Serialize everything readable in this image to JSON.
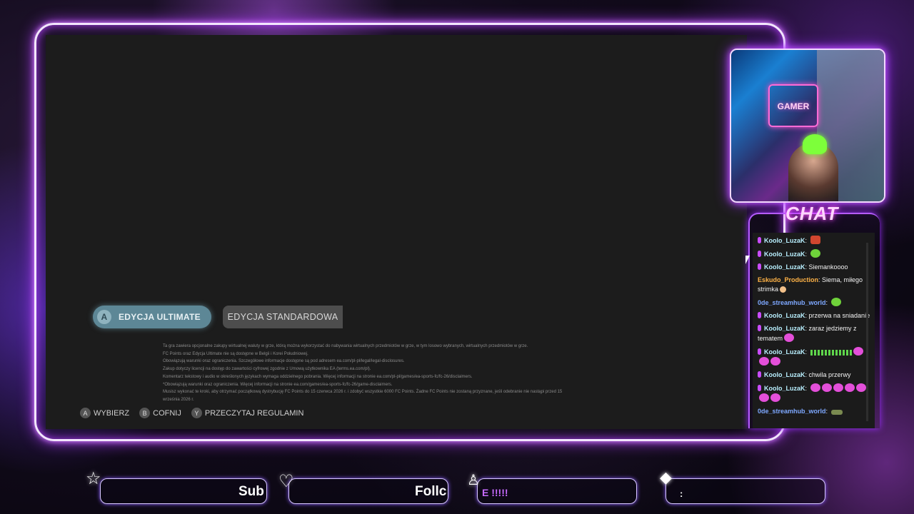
{
  "game_screen": {
    "edition_ultimate": {
      "button_key": "A",
      "label": "EDYCJA ULTIMATE"
    },
    "edition_standard": {
      "label": "EDYCJA STANDARDOWA"
    },
    "legal_lines": [
      "Ta gra zawiera opcjonalne zakupy wirtualnej waluty w grze, którą można wykorzystać do nabywania wirtualnych przedmiotów w grze, w tym losowo wybranych, wirtualnych przedmiotów w grze.",
      "FC Points oraz Edycja Ultimate nie są dostępne w Belgii i Korei Południowej.",
      "Obowiązują warunki oraz ograniczenia. Szczegółowe informacje dostępne są pod adresem ea.com/pl-pl/legal/legal-disclosures.",
      "Zakup dotyczy licencji na dostęp do zawartości cyfrowej zgodnie z Umową użytkownika EA (terms.ea.com/pl).",
      "Komentarz tekstowy i audio w określonych językach wymaga oddzielnego pobrania. Więcej informacji na stronie ea.com/pl-pl/games/ea-sports-fc/fc-26/disclaimers.",
      "*Obowiązują warunki oraz ograniczenia. Więcej informacji na stronie ea.com/games/ea-sports-fc/fc-26/game-disclaimers.",
      "Musisz wykonać te kroki, aby otrzymać początkową dystrybucję FC Points do 15 czerwca 2026 r. i zdobyć wszystkie 6000 FC Points. Żadne FC Points nie zostaną przyznane, jeśli odebranie nie nastąpi przed 15",
      "września 2026 r."
    ],
    "controls": [
      {
        "key": "A",
        "label": "WYBIERZ"
      },
      {
        "key": "B",
        "label": "COFNIJ"
      },
      {
        "key": "Y",
        "label": "PRZECZYTAJ REGULAMIN"
      }
    ]
  },
  "webcam": {
    "sign_text": "GAMER"
  },
  "chat": {
    "title": "CHAT",
    "messages": [
      {
        "user": "Koolo_LuzaK",
        "text": "",
        "user_color": "#b9f0ff",
        "mic": true,
        "emotes": [
          "red"
        ]
      },
      {
        "user": "Koolo_LuzaK",
        "text": "",
        "user_color": "#b9f0ff",
        "mic": true,
        "emotes": [
          "green"
        ]
      },
      {
        "user": "Koolo_LuzaK",
        "text": "Siemankoooo",
        "user_color": "#b9f0ff",
        "mic": true,
        "emotes": []
      },
      {
        "user": "Eskudo_Production",
        "text": "Siema, miłego strimka",
        "user_color": "#ffb347",
        "mic": false,
        "emotes": [
          "face"
        ]
      },
      {
        "user": "0de_streamhub_world",
        "text": "",
        "user_color": "#7ea8ff",
        "mic": false,
        "emotes": [
          "green"
        ]
      },
      {
        "user": "Koolo_LuzaK",
        "text": "przerwa na sniadanie",
        "user_color": "#b9f0ff",
        "mic": true,
        "emotes": []
      },
      {
        "user": "Koolo_LuzaK",
        "text": "zaraz jedziemy z tematem",
        "user_color": "#b9f0ff",
        "mic": true,
        "emotes": [
          "pink"
        ]
      },
      {
        "user": "Koolo_LuzaK",
        "text": "",
        "user_color": "#b9f0ff",
        "mic": true,
        "emotes": [
          "bars",
          "bars",
          "pink",
          "pink",
          "pink"
        ]
      },
      {
        "user": "Koolo_LuzaK",
        "text": "chwila przerwy",
        "user_color": "#b9f0ff",
        "mic": true,
        "emotes": []
      },
      {
        "user": "Koolo_LuzaK",
        "text": "",
        "user_color": "#b9f0ff",
        "mic": true,
        "emotes": [
          "pink",
          "pink",
          "pink",
          "pink",
          "pink",
          "pink",
          "pink"
        ]
      },
      {
        "user": "0de_streamhub_world",
        "text": "",
        "user_color": "#7ea8ff",
        "mic": false,
        "emotes": [
          "gun"
        ]
      }
    ]
  },
  "bottom_bar": {
    "sub": {
      "icon": "star-icon",
      "text": "Sub"
    },
    "follow": {
      "icon": "heart-icon",
      "text": "Follc"
    },
    "viewer": {
      "icon": "user-icon",
      "text": "E !!!!!"
    },
    "donation": {
      "icon": "cube-icon",
      "text": ":"
    }
  }
}
